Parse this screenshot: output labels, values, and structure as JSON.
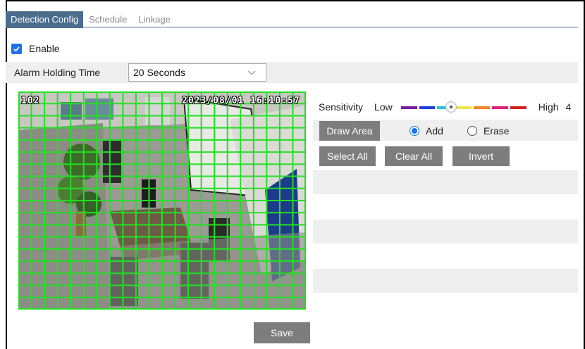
{
  "tabs": [
    {
      "label": "Detection Config",
      "active": true
    },
    {
      "label": "Schedule",
      "active": false
    },
    {
      "label": "Linkage",
      "active": false
    }
  ],
  "enable": {
    "label": "Enable",
    "checked": true
  },
  "alarm_holding": {
    "label": "Alarm Holding Time",
    "value": "20 Seconds"
  },
  "video": {
    "channel_osd": "102",
    "timestamp_osd": "2023/08/01 16:10:57",
    "grid": {
      "columns": 22,
      "rows": 18,
      "color": "#22e022"
    }
  },
  "sensitivity": {
    "label": "Sensitivity",
    "low_label": "Low",
    "high_label": "High",
    "value": "4",
    "level_fraction": 0.4,
    "scale_colors": [
      "#7a1fa2",
      "#1f3fd8",
      "#27c4d8",
      "#f2e34a",
      "#f08a24",
      "#e0247a",
      "#d41f1f"
    ]
  },
  "area_tools": {
    "draw_area_label": "Draw Area",
    "mode_options": [
      {
        "label": "Add",
        "selected": true
      },
      {
        "label": "Erase",
        "selected": false
      }
    ],
    "select_all_label": "Select All",
    "clear_all_label": "Clear All",
    "invert_label": "Invert"
  },
  "save_label": "Save",
  "colors": {
    "accent": "#1a73e8",
    "tab_active": "#4a6d8e",
    "button": "#7d7d7d",
    "row_stripe": "#efefef"
  }
}
